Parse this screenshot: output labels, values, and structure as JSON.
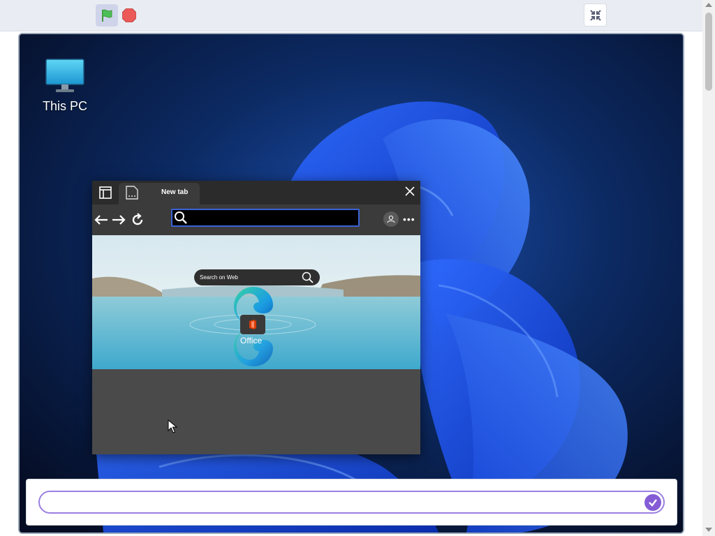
{
  "player": {
    "green_flag_icon": "green-flag-icon",
    "stop_icon": "stop-icon",
    "shrink_icon": "shrink-stage-icon"
  },
  "desktop": {
    "icons": [
      {
        "label": "This PC",
        "icon": "monitor-icon"
      }
    ]
  },
  "browser": {
    "tab_label": "New tab",
    "page_search_placeholder": "Search on Web",
    "office_label": "Office"
  },
  "prompt": {
    "value": "",
    "placeholder": ""
  },
  "colors": {
    "accent_purple": "#855cd6",
    "flag_green": "#4cbf56",
    "stop_red": "#ec5959",
    "address_border": "#3c63d6"
  }
}
